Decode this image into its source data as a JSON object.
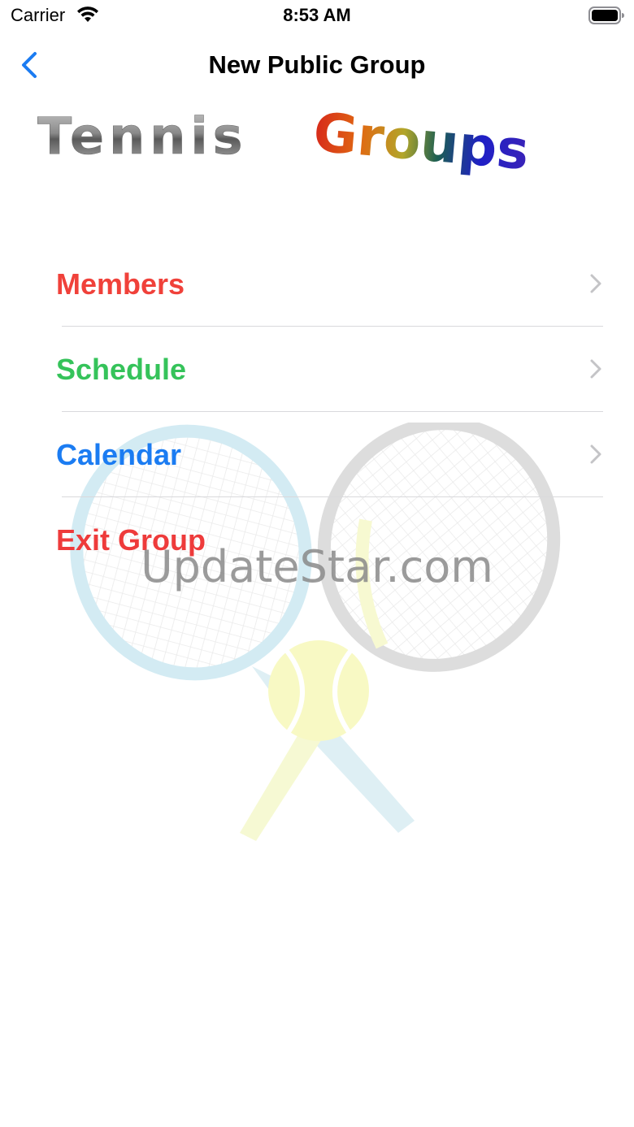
{
  "status_bar": {
    "carrier": "Carrier",
    "time": "8:53 AM"
  },
  "nav": {
    "title": "New Public Group",
    "back_icon": "chevron-left-icon"
  },
  "logo": {
    "word1": "Tennis",
    "word2": "Groups"
  },
  "menu": {
    "items": [
      {
        "label": "Members",
        "color": "#f0413a",
        "has_chevron": true
      },
      {
        "label": "Schedule",
        "color": "#35c35a",
        "has_chevron": true
      },
      {
        "label": "Calendar",
        "color": "#1b7cf2",
        "has_chevron": true
      },
      {
        "label": "Exit Group",
        "color": "#ee3b3b",
        "has_chevron": false
      }
    ]
  },
  "watermark": "UpdateStar.com",
  "colors": {
    "accent": "#1b7cf2",
    "separator": "#d9d9dc",
    "chevron": "#c4c4c7"
  }
}
